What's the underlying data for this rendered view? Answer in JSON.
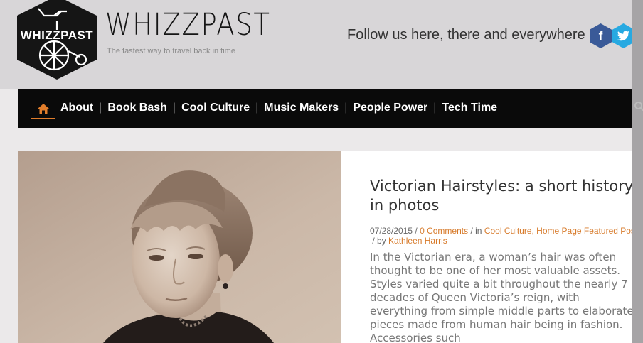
{
  "brand": {
    "logo_text": "WHIZZPAST",
    "name": "WHIZZPAST",
    "tagline": "The fastest way to travel back in time"
  },
  "social": {
    "follow_text": "Follow us here, there and everywhere",
    "icons": [
      "facebook-icon",
      "twitter-icon",
      "google-plus-icon"
    ]
  },
  "nav": {
    "items": [
      {
        "label": "About"
      },
      {
        "label": "Book Bash"
      },
      {
        "label": "Cool Culture"
      },
      {
        "label": "Music Makers"
      },
      {
        "label": "People Power"
      },
      {
        "label": "Tech Time"
      }
    ],
    "separator": "|"
  },
  "article": {
    "title": "Victorian Hairstyles: a short history, in photos",
    "date": "07/28/2015",
    "comments": "0 Comments",
    "in_label": "in",
    "categories": "Cool Culture, Home Page Featured Post",
    "by_label": "by",
    "author": "Kathleen Harris",
    "excerpt": "In the Victorian era, a woman’s hair was often thought to be one of her most valuable assets. Styles varied quite a bit throughout the nearly 7 decades of Queen Victoria’s reign, with everything from simple middle parts to elaborate pieces made from human hair being in fashion. Accessories such"
  },
  "colors": {
    "accent": "#e17d2b",
    "nav_bg": "#0a0a0a",
    "header_bg": "#d8d6d8",
    "facebook": "#3a5a98",
    "twitter": "#27a9e1",
    "google": "#cf2b27"
  }
}
